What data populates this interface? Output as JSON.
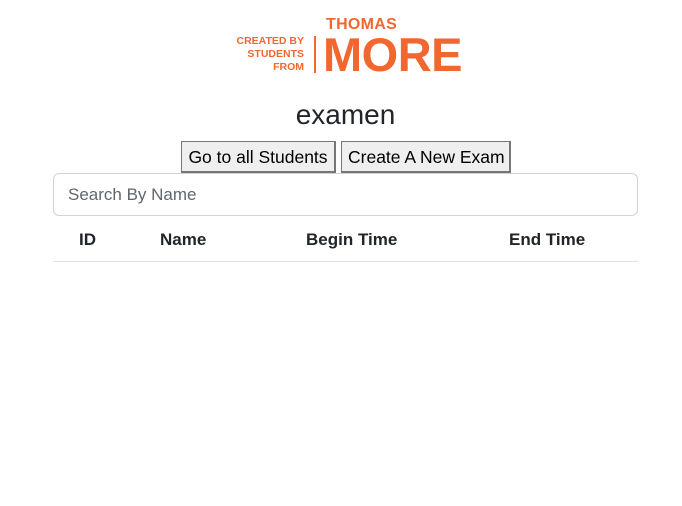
{
  "logo": {
    "line1": "CREATED BY",
    "line2": "STUDENTS",
    "line3": "FROM",
    "brand_top": "THOMAS",
    "brand_main": "MORE",
    "color": "#f2672f"
  },
  "page_title": "examen",
  "buttons": {
    "students_label": "Go to all Students",
    "create_label": "Create A New Exam"
  },
  "search": {
    "placeholder": "Search By Name",
    "value": ""
  },
  "table": {
    "columns": [
      "ID",
      "Name",
      "Begin Time",
      "End Time"
    ],
    "rows": []
  }
}
